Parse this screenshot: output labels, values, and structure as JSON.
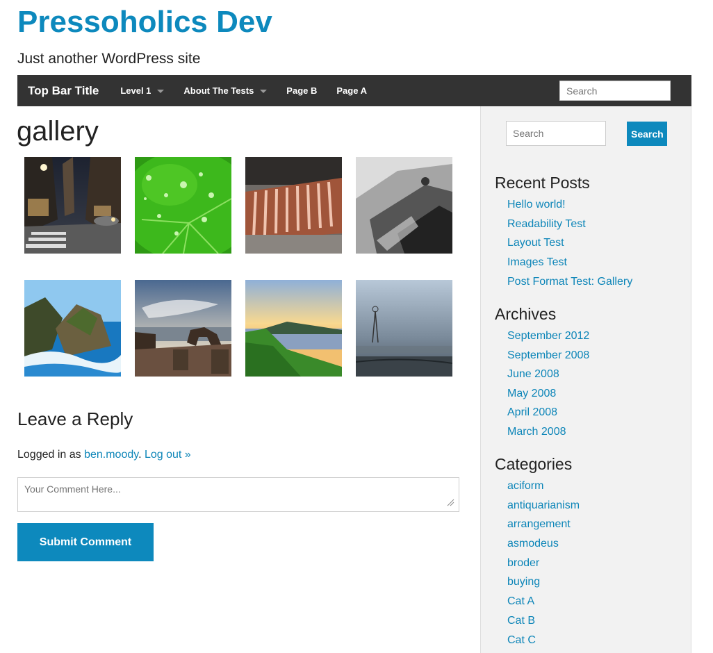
{
  "site": {
    "title": "Pressoholics Dev",
    "tagline": "Just another WordPress site"
  },
  "topbar": {
    "title": "Top Bar Title",
    "items": [
      {
        "label": "Level 1",
        "has_dropdown": true
      },
      {
        "label": "About The Tests",
        "has_dropdown": true
      },
      {
        "label": "Page B",
        "has_dropdown": false
      },
      {
        "label": "Page A",
        "has_dropdown": false
      }
    ],
    "search_placeholder": "Search"
  },
  "main": {
    "page_title": "gallery",
    "gallery": [
      {
        "icon": "city-street-photo"
      },
      {
        "icon": "green-leaf-water-drops-photo"
      },
      {
        "icon": "grilled-meat-photo"
      },
      {
        "icon": "black-white-rock-photo"
      },
      {
        "icon": "sea-cliff-rocks-photo"
      },
      {
        "icon": "beach-rock-arch-photo"
      },
      {
        "icon": "coastline-sunset-photo"
      },
      {
        "icon": "misty-windmill-photo"
      }
    ],
    "reply": {
      "title": "Leave a Reply",
      "logged_in_prefix": "Logged in as ",
      "user": "ben.moody",
      "separator": ". ",
      "logout": "Log out »",
      "comment_placeholder": "Your Comment Here...",
      "submit_label": "Submit Comment"
    }
  },
  "sidebar": {
    "search_placeholder": "Search",
    "search_button": "Search",
    "recent_posts": {
      "title": "Recent Posts",
      "items": [
        "Hello world!",
        "Readability Test",
        "Layout Test",
        "Images Test",
        "Post Format Test: Gallery"
      ]
    },
    "archives": {
      "title": "Archives",
      "items": [
        "September 2012",
        "September 2008",
        "June 2008",
        "May 2008",
        "April 2008",
        "March 2008"
      ]
    },
    "categories": {
      "title": "Categories",
      "items": [
        "aciform",
        "antiquarianism",
        "arrangement",
        "asmodeus",
        "broder",
        "buying",
        "Cat A",
        "Cat B",
        "Cat C"
      ]
    }
  },
  "colors": {
    "accent": "#0d89bd",
    "link": "#0c85b8",
    "topbar_bg": "#333333",
    "sidebar_bg": "#f2f2f2"
  }
}
